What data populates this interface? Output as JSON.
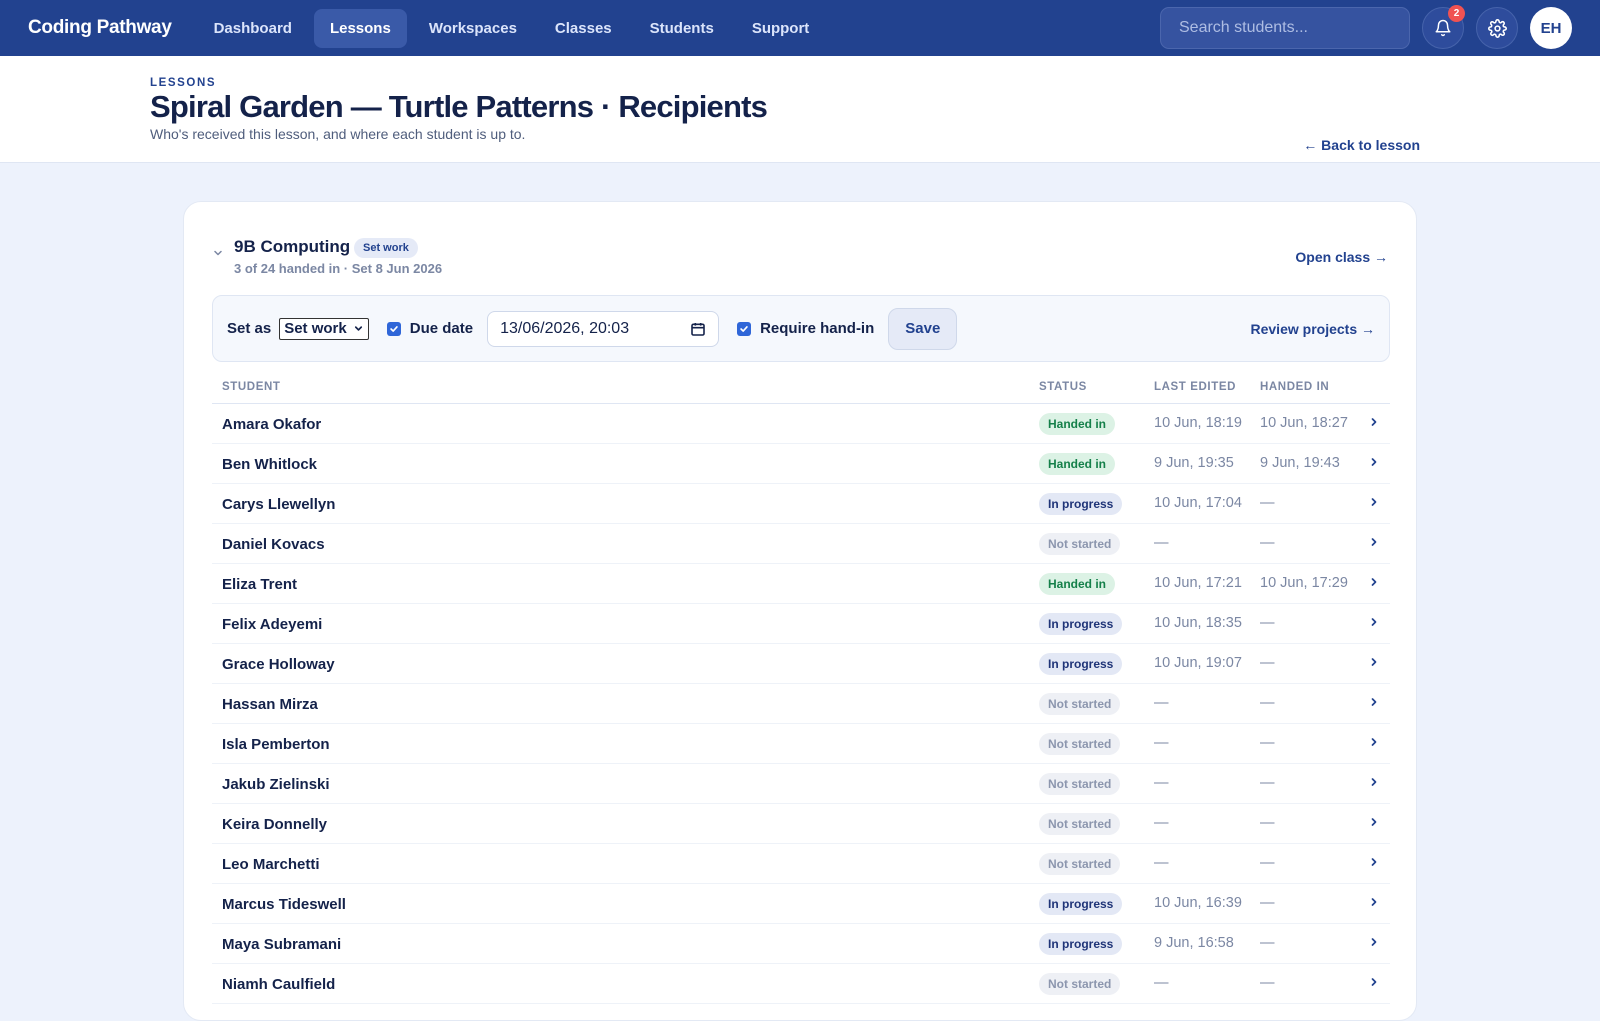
{
  "brand": "Coding Pathway",
  "nav": [
    {
      "label": "Dashboard"
    },
    {
      "label": "Lessons",
      "active": true
    },
    {
      "label": "Workspaces"
    },
    {
      "label": "Classes"
    },
    {
      "label": "Students"
    },
    {
      "label": "Support"
    }
  ],
  "search": {
    "placeholder": "Search students..."
  },
  "notifications": {
    "count": "2"
  },
  "user": {
    "initials": "EH"
  },
  "header": {
    "eyebrow": "LESSONS",
    "title": "Spiral Garden — Turtle Patterns · Recipients",
    "subtitle": "Who's received this lesson, and where each student is up to.",
    "back_label": "← Back to lesson"
  },
  "class": {
    "name": "9B Computing",
    "badge": "Set work",
    "meta": "3 of 24 handed in · Set 8 Jun 2026",
    "open_label": "Open class →"
  },
  "controls": {
    "set_as_label": "Set as",
    "set_as_value": "Set work",
    "due_date_label": "Due date",
    "due_date_checked": true,
    "due_date_value": "13/06/2026, 20:03",
    "require_handin_label": "Require hand-in",
    "require_handin_checked": true,
    "save_label": "Save",
    "review_label": "Review projects →"
  },
  "table": {
    "headers": {
      "student": "STUDENT",
      "status": "STATUS",
      "last_edited": "LAST EDITED",
      "handed_in": "HANDED IN"
    },
    "rows": [
      {
        "name": "Amara Okafor",
        "status": "Handed in",
        "kind": "handed",
        "edited": "10 Jun, 18:19",
        "handed": "10 Jun, 18:27"
      },
      {
        "name": "Ben Whitlock",
        "status": "Handed in",
        "kind": "handed",
        "edited": "9 Jun, 19:35",
        "handed": "9 Jun, 19:43"
      },
      {
        "name": "Carys Llewellyn",
        "status": "In progress",
        "kind": "progress",
        "edited": "10 Jun, 17:04",
        "handed": "—"
      },
      {
        "name": "Daniel Kovacs",
        "status": "Not started",
        "kind": "not",
        "edited": "—",
        "handed": "—"
      },
      {
        "name": "Eliza Trent",
        "status": "Handed in",
        "kind": "handed",
        "edited": "10 Jun, 17:21",
        "handed": "10 Jun, 17:29"
      },
      {
        "name": "Felix Adeyemi",
        "status": "In progress",
        "kind": "progress",
        "edited": "10 Jun, 18:35",
        "handed": "—"
      },
      {
        "name": "Grace Holloway",
        "status": "In progress",
        "kind": "progress",
        "edited": "10 Jun, 19:07",
        "handed": "—"
      },
      {
        "name": "Hassan Mirza",
        "status": "Not started",
        "kind": "not",
        "edited": "—",
        "handed": "—"
      },
      {
        "name": "Isla Pemberton",
        "status": "Not started",
        "kind": "not",
        "edited": "—",
        "handed": "—"
      },
      {
        "name": "Jakub Zielinski",
        "status": "Not started",
        "kind": "not",
        "edited": "—",
        "handed": "—"
      },
      {
        "name": "Keira Donnelly",
        "status": "Not started",
        "kind": "not",
        "edited": "—",
        "handed": "—"
      },
      {
        "name": "Leo Marchetti",
        "status": "Not started",
        "kind": "not",
        "edited": "—",
        "handed": "—"
      },
      {
        "name": "Marcus Tideswell",
        "status": "In progress",
        "kind": "progress",
        "edited": "10 Jun, 16:39",
        "handed": "—"
      },
      {
        "name": "Maya Subramani",
        "status": "In progress",
        "kind": "progress",
        "edited": "9 Jun, 16:58",
        "handed": "—"
      },
      {
        "name": "Niamh Caulfield",
        "status": "Not started",
        "kind": "not",
        "edited": "—",
        "handed": "—"
      }
    ]
  },
  "colors": {
    "nav_bg": "#22428f",
    "accent": "#22428f",
    "page_bg": "#edf2fc",
    "handed": "#15804a",
    "checkbox": "#2f66d8",
    "badge": "#f05252"
  }
}
